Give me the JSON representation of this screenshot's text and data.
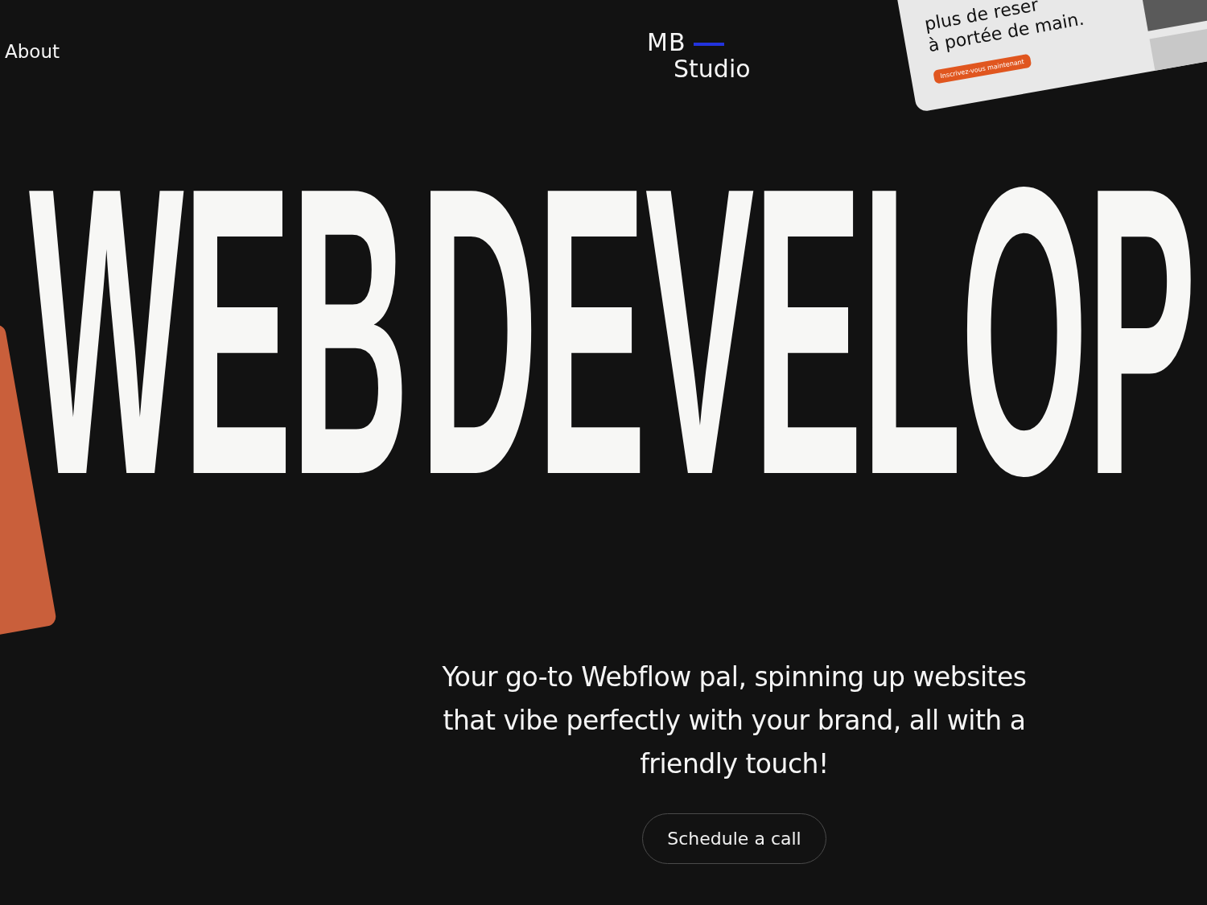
{
  "nav": {
    "link": "About"
  },
  "logo": {
    "line1": "MB",
    "line2": "Studio"
  },
  "mockup_card": {
    "lines": [
      "plus de reser",
      "à portée de main."
    ],
    "button": "Inscrivez-vous maintenant"
  },
  "headline": "WEB DEVELOP",
  "tagline": "Your go-to Webflow pal, spinning up websites that vibe perfectly with your brand, all with a friendly touch!",
  "cta": "Schedule a call"
}
